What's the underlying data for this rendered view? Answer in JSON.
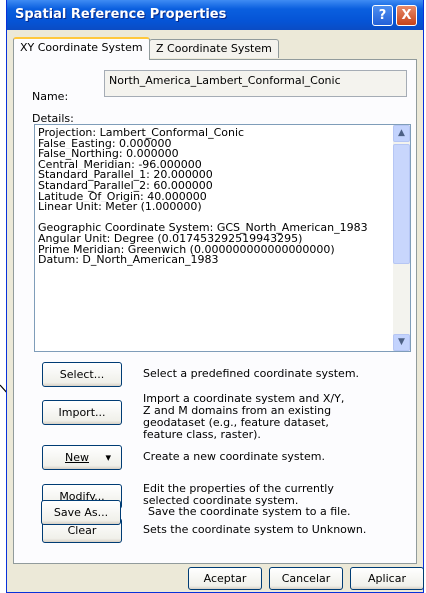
{
  "window": {
    "title": "Spatial Reference Properties",
    "help_glyph": "?",
    "close_glyph": "X"
  },
  "tabs": [
    {
      "label": "XY Coordinate System"
    },
    {
      "label": "Z Coordinate System"
    }
  ],
  "name_label": "Name:",
  "name_value": "North_America_Lambert_Conformal_Conic",
  "details_label": "Details:",
  "details_lines": [
    "Projection: Lambert_Conformal_Conic",
    "False_Easting: 0.000000",
    "False_Northing: 0.000000",
    "Central_Meridian: -96.000000",
    "Standard_Parallel_1: 20.000000",
    "Standard_Parallel_2: 60.000000",
    "Latitude_Of_Origin: 40.000000",
    "Linear Unit: Meter (1.000000)",
    "",
    "Geographic Coordinate System: GCS_North_American_1983",
    "Angular Unit: Degree (0.017453292519943295)",
    "Prime Meridian: Greenwich (0.000000000000000000)",
    "Datum: D_North_American_1983"
  ],
  "actions": [
    {
      "label": "Select...",
      "description": "Select a predefined coordinate system."
    },
    {
      "label": "Import...",
      "description": "Import a coordinate system and X/Y, Z and M domains from an existing geodataset (e.g., feature dataset, feature class, raster)."
    },
    {
      "label": "New",
      "dropdown_glyph": "▾",
      "description": "Create a new coordinate system."
    },
    {
      "label": "Modify...",
      "description": "Edit the properties of the currently selected coordinate system."
    },
    {
      "label": "Clear",
      "description": "Sets the coordinate system to Unknown."
    },
    {
      "label": "Save As...",
      "description": "Save the coordinate system to a file."
    }
  ],
  "footer": {
    "ok": "Aceptar",
    "cancel": "Cancelar",
    "apply": "Aplicar"
  },
  "icons": {
    "scroll_up": "scroll-up-arrow-icon",
    "scroll_down": "scroll-down-arrow-icon",
    "annotation_arrow": "pointer-arrow-icon"
  }
}
